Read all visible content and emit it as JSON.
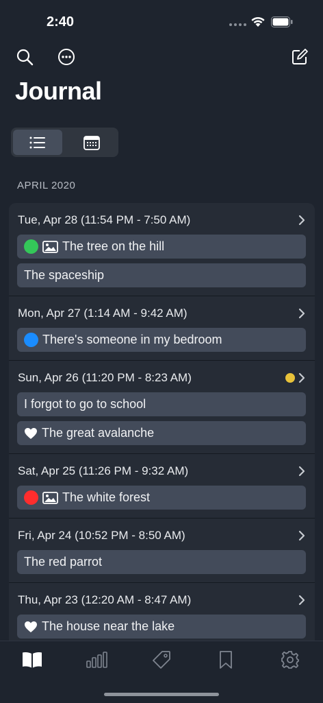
{
  "status": {
    "time": "2:40"
  },
  "title": "Journal",
  "view_toggle": {
    "active": "list",
    "options": [
      "list-icon",
      "calendar-icon"
    ]
  },
  "section": {
    "label": "APRIL 2020"
  },
  "colors": {
    "green": "#34c759",
    "blue": "#1a8cff",
    "red": "#ff2d2d",
    "yellow": "#e8c23a",
    "accent": "#434b5a"
  },
  "entries": [
    {
      "date": "Tue, Apr 28 (11:54 PM - 7:50 AM)",
      "flag": false,
      "dreams": [
        {
          "title": "The tree on the hill",
          "dot": "green",
          "image": true
        },
        {
          "title": "The spaceship",
          "dot": "",
          "image": false
        }
      ]
    },
    {
      "date": "Mon, Apr 27 (1:14 AM - 9:42 AM)",
      "flag": false,
      "dreams": [
        {
          "title": "There's someone in my bedroom",
          "dot": "blue",
          "image": false
        }
      ]
    },
    {
      "date": "Sun, Apr 26 (11:20 PM - 8:23 AM)",
      "flag": true,
      "dreams": [
        {
          "title": "I forgot to go to school",
          "dot": "",
          "image": false
        },
        {
          "title": "The great avalanche",
          "heart": true
        }
      ]
    },
    {
      "date": "Sat, Apr 25 (11:26 PM - 9:32 AM)",
      "flag": false,
      "dreams": [
        {
          "title": "The white forest",
          "dot": "red",
          "image": true
        }
      ]
    },
    {
      "date": "Fri, Apr 24 (10:52 PM - 8:50 AM)",
      "flag": false,
      "dreams": [
        {
          "title": "The red parrot",
          "dot": "",
          "image": false
        }
      ]
    },
    {
      "date": "Thu, Apr 23 (12:20 AM - 8:47 AM)",
      "flag": false,
      "dreams": [
        {
          "title": "The house near the lake",
          "heart": true
        }
      ]
    }
  ],
  "tabs": [
    "journal-icon",
    "stats-icon",
    "tags-icon",
    "bookmarks-icon",
    "settings-icon"
  ]
}
